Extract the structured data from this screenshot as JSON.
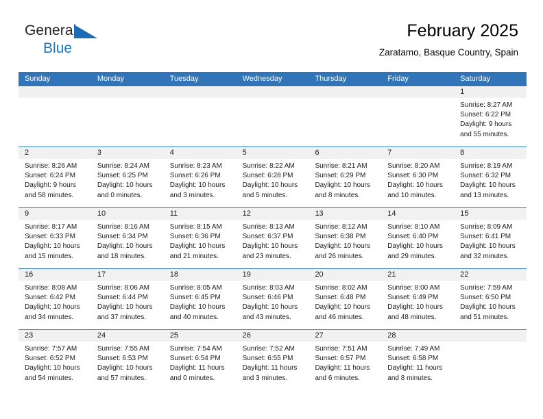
{
  "brand": {
    "name_part1": "General",
    "name_part2": "Blue",
    "accent_color": "#1b6cb3",
    "blue_text_color": "#1b77c4"
  },
  "header": {
    "title": "February 2025",
    "subtitle": "Zaratamo, Basque Country, Spain",
    "header_bar_color": "#3175b8"
  },
  "weekdays": [
    "Sunday",
    "Monday",
    "Tuesday",
    "Wednesday",
    "Thursday",
    "Friday",
    "Saturday"
  ],
  "weeks": [
    [
      {
        "num": "",
        "sunrise": "",
        "sunset": "",
        "daylight1": "",
        "daylight2": "",
        "empty": true
      },
      {
        "num": "",
        "sunrise": "",
        "sunset": "",
        "daylight1": "",
        "daylight2": "",
        "empty": true
      },
      {
        "num": "",
        "sunrise": "",
        "sunset": "",
        "daylight1": "",
        "daylight2": "",
        "empty": true
      },
      {
        "num": "",
        "sunrise": "",
        "sunset": "",
        "daylight1": "",
        "daylight2": "",
        "empty": true
      },
      {
        "num": "",
        "sunrise": "",
        "sunset": "",
        "daylight1": "",
        "daylight2": "",
        "empty": true
      },
      {
        "num": "",
        "sunrise": "",
        "sunset": "",
        "daylight1": "",
        "daylight2": "",
        "empty": true
      },
      {
        "num": "1",
        "sunrise": "Sunrise: 8:27 AM",
        "sunset": "Sunset: 6:22 PM",
        "daylight1": "Daylight: 9 hours",
        "daylight2": "and 55 minutes.",
        "empty": false
      }
    ],
    [
      {
        "num": "2",
        "sunrise": "Sunrise: 8:26 AM",
        "sunset": "Sunset: 6:24 PM",
        "daylight1": "Daylight: 9 hours",
        "daylight2": "and 58 minutes.",
        "empty": false
      },
      {
        "num": "3",
        "sunrise": "Sunrise: 8:24 AM",
        "sunset": "Sunset: 6:25 PM",
        "daylight1": "Daylight: 10 hours",
        "daylight2": "and 0 minutes.",
        "empty": false
      },
      {
        "num": "4",
        "sunrise": "Sunrise: 8:23 AM",
        "sunset": "Sunset: 6:26 PM",
        "daylight1": "Daylight: 10 hours",
        "daylight2": "and 3 minutes.",
        "empty": false
      },
      {
        "num": "5",
        "sunrise": "Sunrise: 8:22 AM",
        "sunset": "Sunset: 6:28 PM",
        "daylight1": "Daylight: 10 hours",
        "daylight2": "and 5 minutes.",
        "empty": false
      },
      {
        "num": "6",
        "sunrise": "Sunrise: 8:21 AM",
        "sunset": "Sunset: 6:29 PM",
        "daylight1": "Daylight: 10 hours",
        "daylight2": "and 8 minutes.",
        "empty": false
      },
      {
        "num": "7",
        "sunrise": "Sunrise: 8:20 AM",
        "sunset": "Sunset: 6:30 PM",
        "daylight1": "Daylight: 10 hours",
        "daylight2": "and 10 minutes.",
        "empty": false
      },
      {
        "num": "8",
        "sunrise": "Sunrise: 8:19 AM",
        "sunset": "Sunset: 6:32 PM",
        "daylight1": "Daylight: 10 hours",
        "daylight2": "and 13 minutes.",
        "empty": false
      }
    ],
    [
      {
        "num": "9",
        "sunrise": "Sunrise: 8:17 AM",
        "sunset": "Sunset: 6:33 PM",
        "daylight1": "Daylight: 10 hours",
        "daylight2": "and 15 minutes.",
        "empty": false
      },
      {
        "num": "10",
        "sunrise": "Sunrise: 8:16 AM",
        "sunset": "Sunset: 6:34 PM",
        "daylight1": "Daylight: 10 hours",
        "daylight2": "and 18 minutes.",
        "empty": false
      },
      {
        "num": "11",
        "sunrise": "Sunrise: 8:15 AM",
        "sunset": "Sunset: 6:36 PM",
        "daylight1": "Daylight: 10 hours",
        "daylight2": "and 21 minutes.",
        "empty": false
      },
      {
        "num": "12",
        "sunrise": "Sunrise: 8:13 AM",
        "sunset": "Sunset: 6:37 PM",
        "daylight1": "Daylight: 10 hours",
        "daylight2": "and 23 minutes.",
        "empty": false
      },
      {
        "num": "13",
        "sunrise": "Sunrise: 8:12 AM",
        "sunset": "Sunset: 6:38 PM",
        "daylight1": "Daylight: 10 hours",
        "daylight2": "and 26 minutes.",
        "empty": false
      },
      {
        "num": "14",
        "sunrise": "Sunrise: 8:10 AM",
        "sunset": "Sunset: 6:40 PM",
        "daylight1": "Daylight: 10 hours",
        "daylight2": "and 29 minutes.",
        "empty": false
      },
      {
        "num": "15",
        "sunrise": "Sunrise: 8:09 AM",
        "sunset": "Sunset: 6:41 PM",
        "daylight1": "Daylight: 10 hours",
        "daylight2": "and 32 minutes.",
        "empty": false
      }
    ],
    [
      {
        "num": "16",
        "sunrise": "Sunrise: 8:08 AM",
        "sunset": "Sunset: 6:42 PM",
        "daylight1": "Daylight: 10 hours",
        "daylight2": "and 34 minutes.",
        "empty": false
      },
      {
        "num": "17",
        "sunrise": "Sunrise: 8:06 AM",
        "sunset": "Sunset: 6:44 PM",
        "daylight1": "Daylight: 10 hours",
        "daylight2": "and 37 minutes.",
        "empty": false
      },
      {
        "num": "18",
        "sunrise": "Sunrise: 8:05 AM",
        "sunset": "Sunset: 6:45 PM",
        "daylight1": "Daylight: 10 hours",
        "daylight2": "and 40 minutes.",
        "empty": false
      },
      {
        "num": "19",
        "sunrise": "Sunrise: 8:03 AM",
        "sunset": "Sunset: 6:46 PM",
        "daylight1": "Daylight: 10 hours",
        "daylight2": "and 43 minutes.",
        "empty": false
      },
      {
        "num": "20",
        "sunrise": "Sunrise: 8:02 AM",
        "sunset": "Sunset: 6:48 PM",
        "daylight1": "Daylight: 10 hours",
        "daylight2": "and 46 minutes.",
        "empty": false
      },
      {
        "num": "21",
        "sunrise": "Sunrise: 8:00 AM",
        "sunset": "Sunset: 6:49 PM",
        "daylight1": "Daylight: 10 hours",
        "daylight2": "and 48 minutes.",
        "empty": false
      },
      {
        "num": "22",
        "sunrise": "Sunrise: 7:59 AM",
        "sunset": "Sunset: 6:50 PM",
        "daylight1": "Daylight: 10 hours",
        "daylight2": "and 51 minutes.",
        "empty": false
      }
    ],
    [
      {
        "num": "23",
        "sunrise": "Sunrise: 7:57 AM",
        "sunset": "Sunset: 6:52 PM",
        "daylight1": "Daylight: 10 hours",
        "daylight2": "and 54 minutes.",
        "empty": false
      },
      {
        "num": "24",
        "sunrise": "Sunrise: 7:55 AM",
        "sunset": "Sunset: 6:53 PM",
        "daylight1": "Daylight: 10 hours",
        "daylight2": "and 57 minutes.",
        "empty": false
      },
      {
        "num": "25",
        "sunrise": "Sunrise: 7:54 AM",
        "sunset": "Sunset: 6:54 PM",
        "daylight1": "Daylight: 11 hours",
        "daylight2": "and 0 minutes.",
        "empty": false
      },
      {
        "num": "26",
        "sunrise": "Sunrise: 7:52 AM",
        "sunset": "Sunset: 6:55 PM",
        "daylight1": "Daylight: 11 hours",
        "daylight2": "and 3 minutes.",
        "empty": false
      },
      {
        "num": "27",
        "sunrise": "Sunrise: 7:51 AM",
        "sunset": "Sunset: 6:57 PM",
        "daylight1": "Daylight: 11 hours",
        "daylight2": "and 6 minutes.",
        "empty": false
      },
      {
        "num": "28",
        "sunrise": "Sunrise: 7:49 AM",
        "sunset": "Sunset: 6:58 PM",
        "daylight1": "Daylight: 11 hours",
        "daylight2": "and 8 minutes.",
        "empty": false
      },
      {
        "num": "",
        "sunrise": "",
        "sunset": "",
        "daylight1": "",
        "daylight2": "",
        "empty": true
      }
    ]
  ]
}
